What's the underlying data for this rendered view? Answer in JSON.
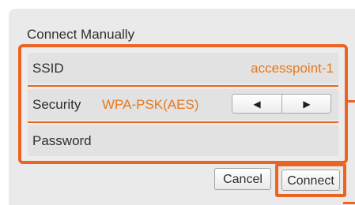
{
  "dialog": {
    "title": "Connect Manually"
  },
  "form": {
    "ssid": {
      "label": "SSID",
      "value": "accesspoint-1"
    },
    "security": {
      "label": "Security",
      "value": "WPA-PSK(AES)",
      "prev_glyph": "◀",
      "next_glyph": "▶"
    },
    "password": {
      "label": "Password"
    }
  },
  "buttons": {
    "cancel": "Cancel",
    "connect": "Connect"
  },
  "colors": {
    "highlight": "#ec6424",
    "value_text": "#e47a1f",
    "panel_bg": "#eaeaea"
  }
}
